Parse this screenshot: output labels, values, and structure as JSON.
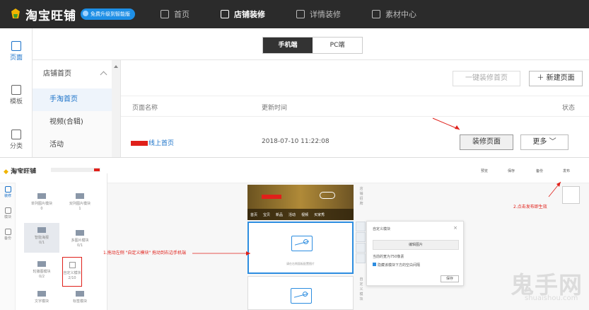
{
  "topbar": {
    "app_name": "淘宝旺铺",
    "badge": "免费升级到智能版",
    "nav": [
      {
        "label": "首页",
        "icon": "home-icon"
      },
      {
        "label": "店铺装修",
        "icon": "store-icon",
        "active": true
      },
      {
        "label": "详情装修",
        "icon": "detail-icon"
      },
      {
        "label": "素材中心",
        "icon": "folder-icon"
      }
    ]
  },
  "rail": [
    {
      "label": "页面",
      "active": true,
      "icon": "page-icon"
    },
    {
      "label": "模板",
      "icon": "template-icon"
    },
    {
      "label": "分类",
      "icon": "category-icon"
    }
  ],
  "device_tabs": {
    "mobile": "手机端",
    "pc": "PC端"
  },
  "subnav": {
    "group": "店铺首页",
    "items": [
      {
        "label": "手淘首页",
        "active": true
      },
      {
        "label": "视频(合辑)"
      },
      {
        "label": "活动"
      }
    ]
  },
  "toolbar": {
    "one_click": "一键装修首页",
    "new_page": "＋ 新建页面"
  },
  "table": {
    "headers": [
      "页面名称",
      "更新时间",
      "状态"
    ],
    "row": {
      "name": "线上首页",
      "time": "2018-07-10 11:22:08",
      "decorate": "装修页面",
      "more": "更多"
    }
  },
  "editor": {
    "title": "淘宝旺铺",
    "header_items": [
      "预览",
      "保存",
      "备份",
      "发布"
    ],
    "rail": [
      "装修",
      "模块",
      "备份"
    ],
    "modules": [
      {
        "name": "单列图片模块",
        "count": "0"
      },
      {
        "name": "双列图片模块",
        "count": "1"
      },
      {
        "name": "智能海报",
        "count": "0/1"
      },
      {
        "name": "多图片模块",
        "count": "0/1"
      },
      {
        "name": "轮播图模块",
        "count": "0/2"
      },
      {
        "name": "自定义模块",
        "count": "2/10"
      },
      {
        "name": "文字模块",
        "count": ""
      },
      {
        "name": "标签模块",
        "count": ""
      }
    ],
    "phone_nav": [
      "首页",
      "宝贝",
      "新品",
      "活动",
      "视频",
      "买家秀"
    ],
    "block_hint": "请在右侧面板配置图片",
    "side_labels": [
      "店铺招牌",
      "自定义模块"
    ],
    "popup": {
      "title": "自定义模块",
      "edit": "编辑图片",
      "size_note": "当前的宽为750像素",
      "checkbox": "隐藏该模块下方的空白间隔",
      "save": "保存"
    }
  },
  "annotations": {
    "a1": "1.拖动左侧 \"自定义模块\" 拖动到右边手机端",
    "a2": "2.点击发布即生效"
  },
  "watermark": {
    "text": "鬼手网",
    "url": "shuaishou.com"
  },
  "colors": {
    "topbar": "#2b2b2b",
    "accent": "#1a72c9",
    "annotation": "#e0201a"
  }
}
